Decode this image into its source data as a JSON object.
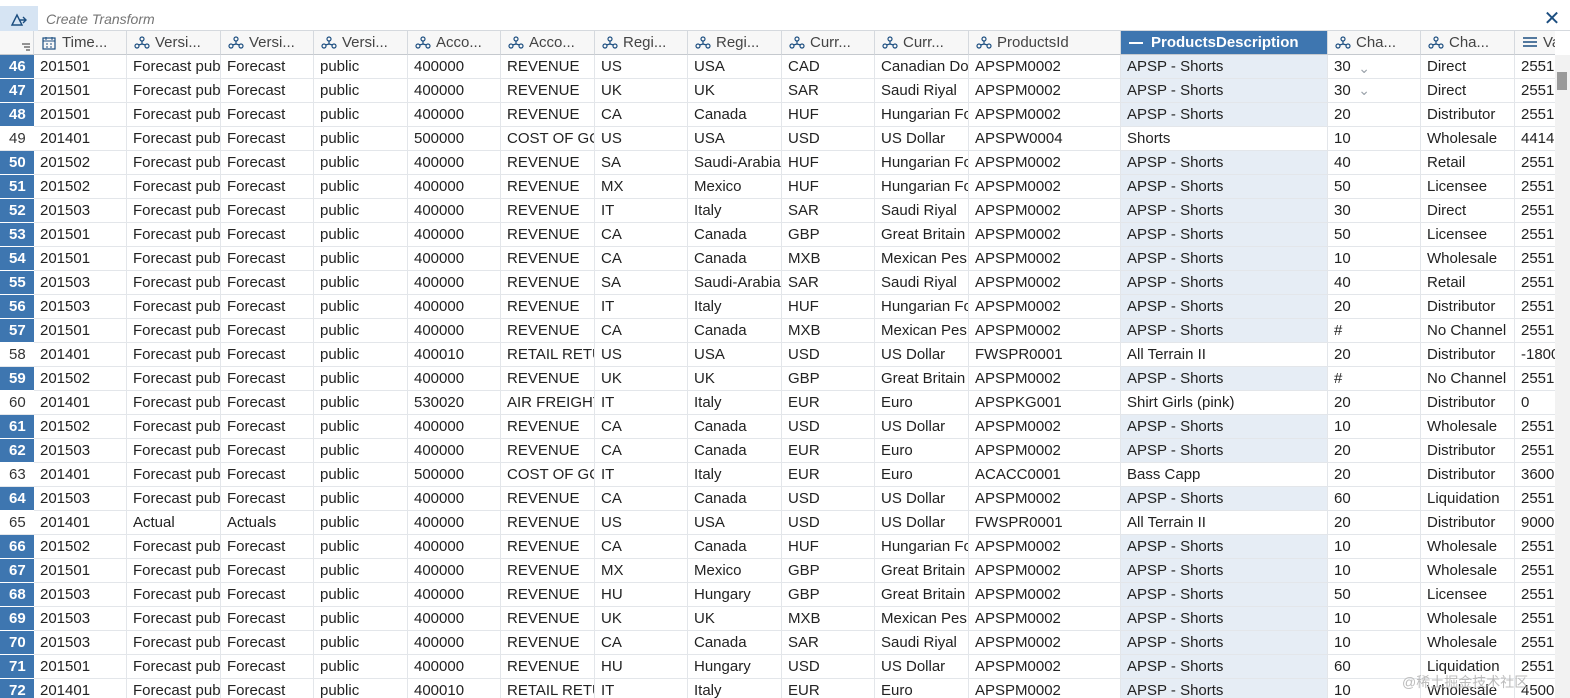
{
  "toolbar": {
    "transform_placeholder": "Create Transform",
    "close_glyph": "✕"
  },
  "columns": [
    {
      "label": "Time...",
      "icon": "calendar-icon"
    },
    {
      "label": "Versi...",
      "icon": "dimension-icon"
    },
    {
      "label": "Versi...",
      "icon": "dimension-icon"
    },
    {
      "label": "Versi...",
      "icon": "dimension-icon"
    },
    {
      "label": "Acco...",
      "icon": "dimension-icon"
    },
    {
      "label": "Acco...",
      "icon": "dimension-icon"
    },
    {
      "label": "Regi...",
      "icon": "dimension-icon"
    },
    {
      "label": "Regi...",
      "icon": "dimension-icon"
    },
    {
      "label": "Curr...",
      "icon": "dimension-icon"
    },
    {
      "label": "Curr...",
      "icon": "dimension-icon"
    },
    {
      "label": "ProductsId",
      "icon": "dimension-icon"
    },
    {
      "label": "ProductsDescription",
      "icon": "minus-icon",
      "selected": true
    },
    {
      "label": "Cha...",
      "icon": "dimension-icon"
    },
    {
      "label": "Cha...",
      "icon": "dimension-icon"
    },
    {
      "label": "Val",
      "icon": "measure-icon"
    }
  ],
  "rows": [
    {
      "n": "46",
      "hl": true,
      "c": [
        "201501",
        "Forecast pub",
        "Forecast",
        "public",
        "400000",
        "REVENUE",
        "US",
        "USA",
        "CAD",
        "Canadian Do",
        "APSPM0002",
        "APSP - Shorts",
        "30",
        "Direct",
        "2551"
      ]
    },
    {
      "n": "47",
      "hl": true,
      "c": [
        "201501",
        "Forecast pub",
        "Forecast",
        "public",
        "400000",
        "REVENUE",
        "UK",
        "UK",
        "SAR",
        "Saudi Riyal",
        "APSPM0002",
        "APSP - Shorts",
        "30",
        "Direct",
        "2551"
      ]
    },
    {
      "n": "48",
      "hl": true,
      "c": [
        "201501",
        "Forecast pub",
        "Forecast",
        "public",
        "400000",
        "REVENUE",
        "CA",
        "Canada",
        "HUF",
        "Hungarian Fo",
        "APSPM0002",
        "APSP - Shorts",
        "20",
        "Distributor",
        "2551"
      ]
    },
    {
      "n": "49",
      "hl": false,
      "c": [
        "201401",
        "Forecast pub",
        "Forecast",
        "public",
        "500000",
        "COST OF GO",
        "US",
        "USA",
        "USD",
        "US Dollar",
        "APSPW0004",
        "Shorts",
        "10",
        "Wholesale",
        "4414"
      ]
    },
    {
      "n": "50",
      "hl": true,
      "c": [
        "201502",
        "Forecast pub",
        "Forecast",
        "public",
        "400000",
        "REVENUE",
        "SA",
        "Saudi-Arabia",
        "HUF",
        "Hungarian Fo",
        "APSPM0002",
        "APSP - Shorts",
        "40",
        "Retail",
        "2551"
      ]
    },
    {
      "n": "51",
      "hl": true,
      "c": [
        "201502",
        "Forecast pub",
        "Forecast",
        "public",
        "400000",
        "REVENUE",
        "MX",
        "Mexico",
        "HUF",
        "Hungarian Fo",
        "APSPM0002",
        "APSP - Shorts",
        "50",
        "Licensee",
        "2551"
      ]
    },
    {
      "n": "52",
      "hl": true,
      "c": [
        "201503",
        "Forecast pub",
        "Forecast",
        "public",
        "400000",
        "REVENUE",
        "IT",
        "Italy",
        "SAR",
        "Saudi Riyal",
        "APSPM0002",
        "APSP - Shorts",
        "30",
        "Direct",
        "2551"
      ]
    },
    {
      "n": "53",
      "hl": true,
      "c": [
        "201501",
        "Forecast pub",
        "Forecast",
        "public",
        "400000",
        "REVENUE",
        "CA",
        "Canada",
        "GBP",
        "Great Britain",
        "APSPM0002",
        "APSP - Shorts",
        "50",
        "Licensee",
        "2551"
      ]
    },
    {
      "n": "54",
      "hl": true,
      "c": [
        "201501",
        "Forecast pub",
        "Forecast",
        "public",
        "400000",
        "REVENUE",
        "CA",
        "Canada",
        "MXB",
        "Mexican Pes",
        "APSPM0002",
        "APSP - Shorts",
        "10",
        "Wholesale",
        "2551"
      ]
    },
    {
      "n": "55",
      "hl": true,
      "c": [
        "201503",
        "Forecast pub",
        "Forecast",
        "public",
        "400000",
        "REVENUE",
        "SA",
        "Saudi-Arabia",
        "SAR",
        "Saudi Riyal",
        "APSPM0002",
        "APSP - Shorts",
        "40",
        "Retail",
        "2551"
      ]
    },
    {
      "n": "56",
      "hl": true,
      "c": [
        "201503",
        "Forecast pub",
        "Forecast",
        "public",
        "400000",
        "REVENUE",
        "IT",
        "Italy",
        "HUF",
        "Hungarian Fo",
        "APSPM0002",
        "APSP - Shorts",
        "20",
        "Distributor",
        "2551"
      ]
    },
    {
      "n": "57",
      "hl": true,
      "c": [
        "201501",
        "Forecast pub",
        "Forecast",
        "public",
        "400000",
        "REVENUE",
        "CA",
        "Canada",
        "MXB",
        "Mexican Pes",
        "APSPM0002",
        "APSP - Shorts",
        "#",
        "No Channel",
        "2551"
      ]
    },
    {
      "n": "58",
      "hl": false,
      "c": [
        "201401",
        "Forecast pub",
        "Forecast",
        "public",
        "400010",
        "RETAIL RETU",
        "US",
        "USA",
        "USD",
        "US Dollar",
        "FWSPR0001",
        "All Terrain II",
        "20",
        "Distributor",
        "-1800"
      ]
    },
    {
      "n": "59",
      "hl": true,
      "c": [
        "201502",
        "Forecast pub",
        "Forecast",
        "public",
        "400000",
        "REVENUE",
        "UK",
        "UK",
        "GBP",
        "Great Britain",
        "APSPM0002",
        "APSP - Shorts",
        "#",
        "No Channel",
        "2551"
      ]
    },
    {
      "n": "60",
      "hl": false,
      "c": [
        "201401",
        "Forecast pub",
        "Forecast",
        "public",
        "530020",
        "AIR FREIGHT",
        "IT",
        "Italy",
        "EUR",
        "Euro",
        "APSPKG001",
        "Shirt Girls (pink)",
        "20",
        "Distributor",
        "0"
      ]
    },
    {
      "n": "61",
      "hl": true,
      "c": [
        "201502",
        "Forecast pub",
        "Forecast",
        "public",
        "400000",
        "REVENUE",
        "CA",
        "Canada",
        "USD",
        "US Dollar",
        "APSPM0002",
        "APSP - Shorts",
        "10",
        "Wholesale",
        "2551"
      ]
    },
    {
      "n": "62",
      "hl": true,
      "c": [
        "201503",
        "Forecast pub",
        "Forecast",
        "public",
        "400000",
        "REVENUE",
        "CA",
        "Canada",
        "EUR",
        "Euro",
        "APSPM0002",
        "APSP - Shorts",
        "20",
        "Distributor",
        "2551"
      ]
    },
    {
      "n": "63",
      "hl": false,
      "c": [
        "201401",
        "Forecast pub",
        "Forecast",
        "public",
        "500000",
        "COST OF GO",
        "IT",
        "Italy",
        "EUR",
        "Euro",
        "ACACC0001",
        "Bass Capp",
        "20",
        "Distributor",
        "3600"
      ]
    },
    {
      "n": "64",
      "hl": true,
      "c": [
        "201503",
        "Forecast pub",
        "Forecast",
        "public",
        "400000",
        "REVENUE",
        "CA",
        "Canada",
        "USD",
        "US Dollar",
        "APSPM0002",
        "APSP - Shorts",
        "60",
        "Liquidation",
        "2551"
      ]
    },
    {
      "n": "65",
      "hl": false,
      "c": [
        "201401",
        "Actual",
        "Actuals",
        "public",
        "400000",
        "REVENUE",
        "US",
        "USA",
        "USD",
        "US Dollar",
        "FWSPR0001",
        "All Terrain II",
        "20",
        "Distributor",
        "9000"
      ]
    },
    {
      "n": "66",
      "hl": true,
      "c": [
        "201502",
        "Forecast pub",
        "Forecast",
        "public",
        "400000",
        "REVENUE",
        "CA",
        "Canada",
        "HUF",
        "Hungarian Fo",
        "APSPM0002",
        "APSP - Shorts",
        "10",
        "Wholesale",
        "2551"
      ]
    },
    {
      "n": "67",
      "hl": true,
      "c": [
        "201501",
        "Forecast pub",
        "Forecast",
        "public",
        "400000",
        "REVENUE",
        "MX",
        "Mexico",
        "GBP",
        "Great Britain",
        "APSPM0002",
        "APSP - Shorts",
        "10",
        "Wholesale",
        "2551"
      ]
    },
    {
      "n": "68",
      "hl": true,
      "c": [
        "201503",
        "Forecast pub",
        "Forecast",
        "public",
        "400000",
        "REVENUE",
        "HU",
        "Hungary",
        "GBP",
        "Great Britain",
        "APSPM0002",
        "APSP - Shorts",
        "50",
        "Licensee",
        "2551"
      ]
    },
    {
      "n": "69",
      "hl": true,
      "c": [
        "201503",
        "Forecast pub",
        "Forecast",
        "public",
        "400000",
        "REVENUE",
        "UK",
        "UK",
        "MXB",
        "Mexican Pes",
        "APSPM0002",
        "APSP - Shorts",
        "10",
        "Wholesale",
        "2551"
      ]
    },
    {
      "n": "70",
      "hl": true,
      "c": [
        "201503",
        "Forecast pub",
        "Forecast",
        "public",
        "400000",
        "REVENUE",
        "CA",
        "Canada",
        "SAR",
        "Saudi Riyal",
        "APSPM0002",
        "APSP - Shorts",
        "10",
        "Wholesale",
        "2551"
      ]
    },
    {
      "n": "71",
      "hl": true,
      "c": [
        "201501",
        "Forecast pub",
        "Forecast",
        "public",
        "400000",
        "REVENUE",
        "HU",
        "Hungary",
        "USD",
        "US Dollar",
        "APSPM0002",
        "APSP - Shorts",
        "60",
        "Liquidation",
        "2551"
      ]
    },
    {
      "n": "72",
      "hl": true,
      "c": [
        "201401",
        "Forecast pub",
        "Forecast",
        "public",
        "400010",
        "RETAIL RETU",
        "IT",
        "Italy",
        "EUR",
        "Euro",
        "APSPM0002",
        "APSP - Shorts",
        "10",
        "Wholesale",
        "4500"
      ]
    }
  ],
  "watermark": "@稀土掘金技术社区",
  "colors": {
    "accent": "#3e76b0",
    "selected_col_bg": "#e6edf5",
    "icon": "#1c4e80"
  }
}
